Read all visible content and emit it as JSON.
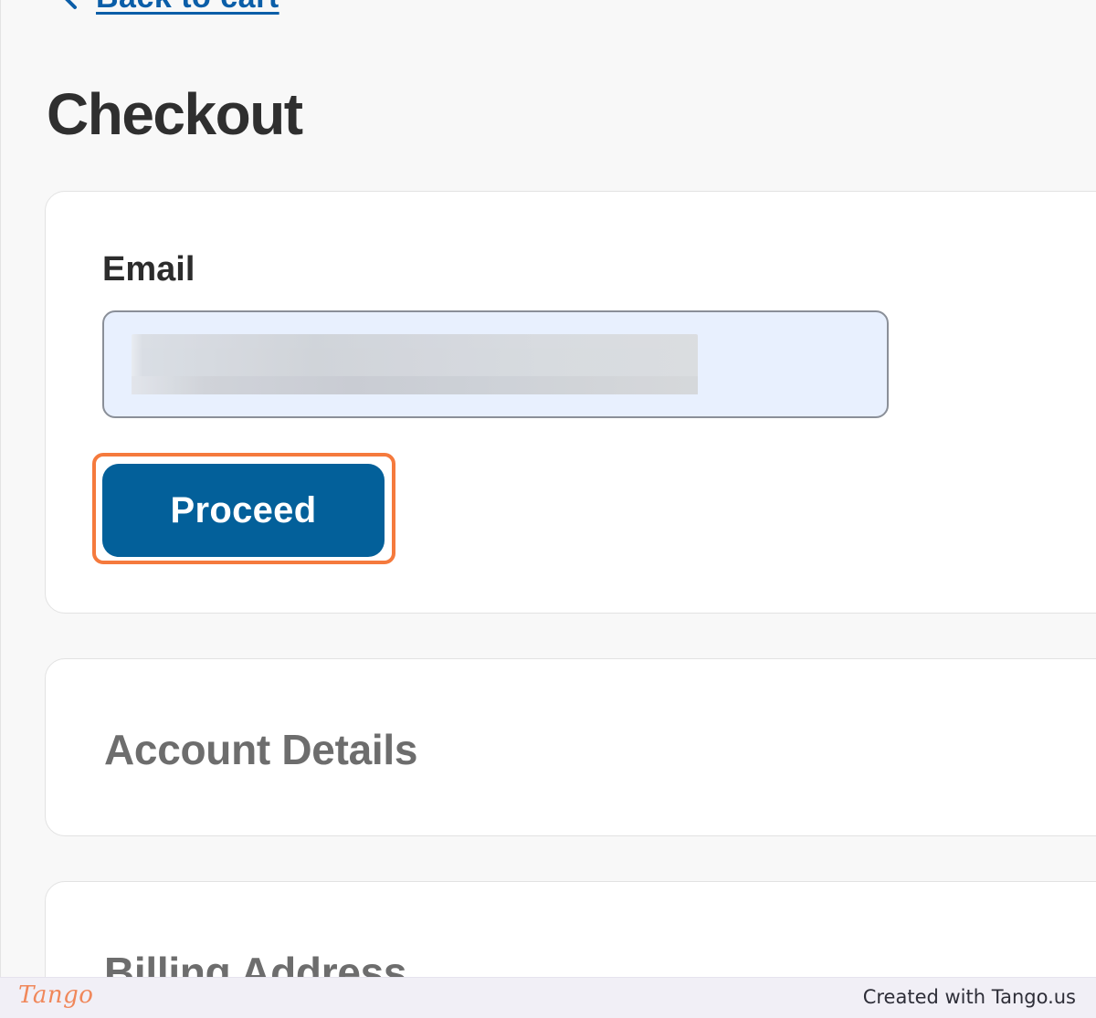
{
  "nav": {
    "back_label": "Back to cart",
    "back_icon": "chevron-left-icon"
  },
  "page": {
    "title": "Checkout"
  },
  "email_section": {
    "label": "Email",
    "input_value": "",
    "input_value_redacted": true,
    "proceed_label": "Proceed"
  },
  "account_section": {
    "title": "Account Details"
  },
  "billing_section": {
    "title": "Billing Address"
  },
  "footer": {
    "logo_text": "Tango",
    "credit_text": "Created with Tango.us"
  },
  "colors": {
    "accent": "#03609a",
    "link": "#0b5ea8",
    "highlight": "#f57a3d",
    "input_autofill_bg": "#e8f0fe"
  }
}
